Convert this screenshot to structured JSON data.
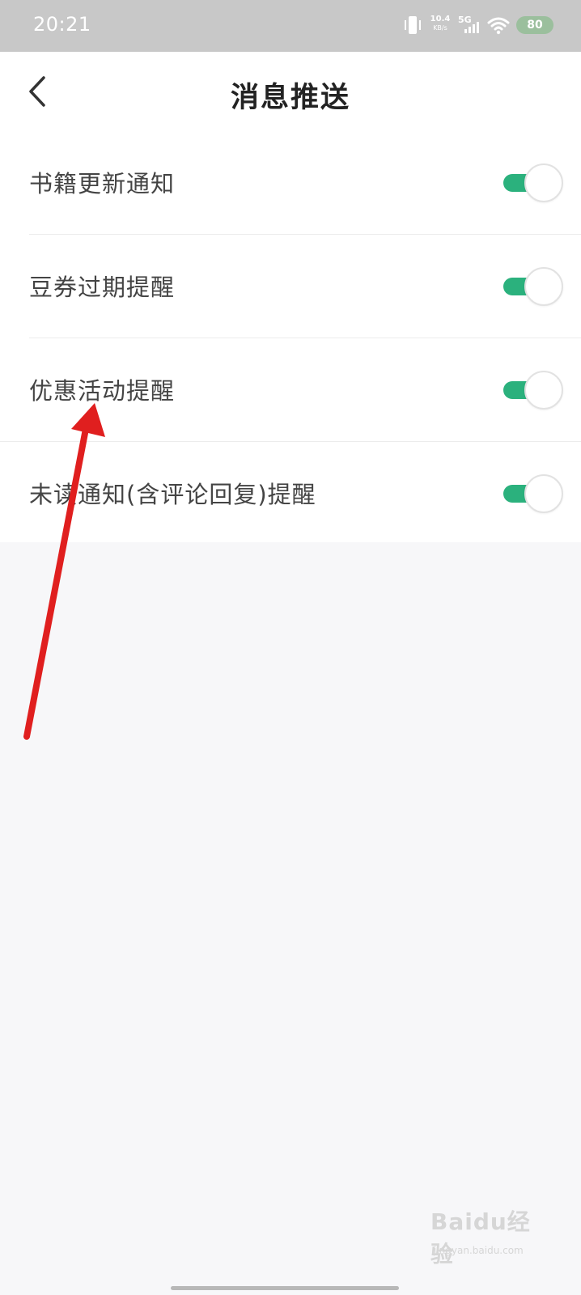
{
  "status_bar": {
    "time": "20:21",
    "net_speed_value": "10.4",
    "net_speed_unit": "KB/s",
    "network_type": "5G",
    "battery_level": "80",
    "icons": [
      "vibrate-icon",
      "signal-icon",
      "wifi-icon",
      "battery-icon"
    ]
  },
  "header": {
    "title": "消息推送",
    "back_icon": "chevron-left-icon"
  },
  "settings": [
    {
      "label": "书籍更新通知",
      "enabled": true
    },
    {
      "label": "豆券过期提醒",
      "enabled": true
    },
    {
      "label": "优惠活动提醒",
      "enabled": true
    },
    {
      "label": "未读通知(含评论回复)提醒",
      "enabled": true
    }
  ],
  "colors": {
    "toggle_on": "#2bb17d",
    "status_bar": "#c8c8c8",
    "annotation_arrow": "#e01f1f",
    "page_background": "#f7f7f9"
  },
  "watermark": {
    "main": "Baidu经验",
    "sub": "jingyan.baidu.com"
  }
}
